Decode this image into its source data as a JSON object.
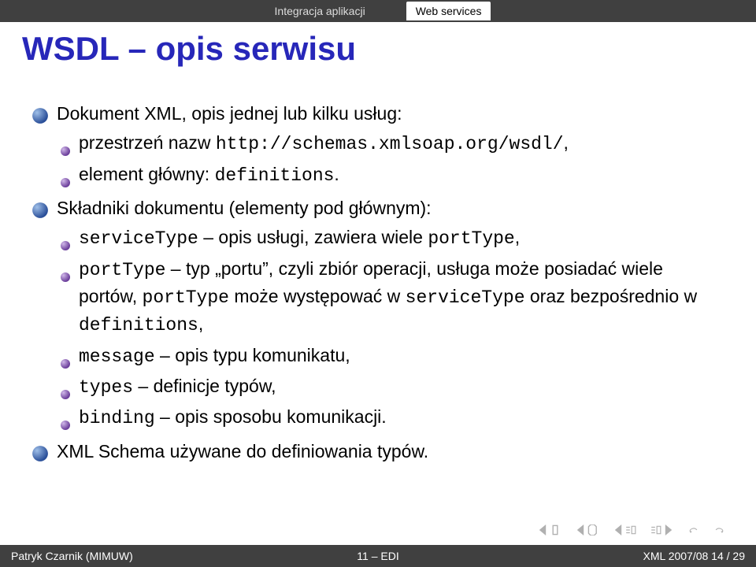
{
  "topnav": {
    "tab1": "Integracja aplikacji",
    "tab2": "Web services"
  },
  "title": "WSDL – opis serwisu",
  "items": [
    {
      "lead": "Dokument XML, opis jednej lub kilku usług:",
      "sub": [
        {
          "pre": "przestrzeń nazw ",
          "code": "http://schemas.xmlsoap.org/wsdl/",
          "post": ","
        },
        {
          "pre": "element główny: ",
          "code": "definitions",
          "post": "."
        }
      ]
    },
    {
      "lead": "Składniki dokumentu (elementy pod głównym):",
      "sub": [
        {
          "code": "serviceType",
          "pre2": " – opis usługi, zawiera wiele ",
          "code2": "portType",
          "post": ","
        },
        {
          "code": "portType",
          "pre2": " – typ „portu”, czyli zbiór operacji, usługa może posiadać wiele portów, ",
          "code2": "portType",
          "pre3": " może występować w ",
          "code3": "serviceType",
          "pre4": " oraz bezpośrednio w ",
          "code4": "definitions",
          "post": ","
        },
        {
          "code": "message",
          "pre2": " – opis typu komunikatu,",
          "post": ""
        },
        {
          "code": "types",
          "pre2": " – definicje typów,",
          "post": ""
        },
        {
          "code": "binding",
          "pre2": " – opis sposobu komunikacji.",
          "post": ""
        }
      ]
    },
    {
      "lead": "XML Schema używane do definiowania typów."
    }
  ],
  "footer": {
    "author": "Patryk Czarnik (MIMUW)",
    "center": "11 – EDI",
    "right": "XML 2007/08    14 / 29"
  }
}
